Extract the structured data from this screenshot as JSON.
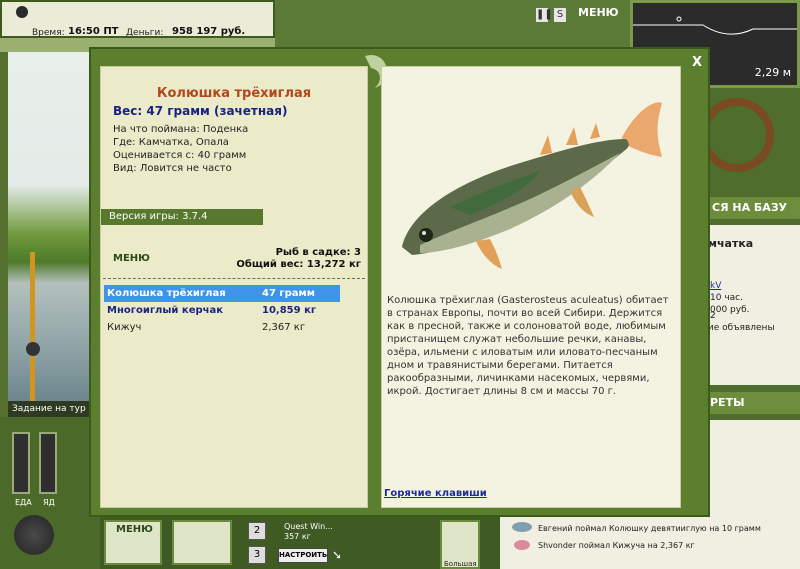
{
  "status": {
    "time_label": "Время:",
    "time_value": "16:50 ПТ",
    "money_label": "Деньги:",
    "money_value": "958 197 руб."
  },
  "top_right": {
    "menu_label": "МЕНЮ",
    "depth": "2,29 м",
    "pause_icon": "pause-icon",
    "speed_icon": "s-icon"
  },
  "background": {
    "task_label": "Задание на тур",
    "food_label": "ЕДА",
    "water_label": "ЯД",
    "base_button": "СЯ НА БАЗУ",
    "location_title": "мчатка",
    "loc_line1": "kV",
    "loc_line2": "10 час.",
    "loc_line3": "000 руб.",
    "loc_line4": "2",
    "loc_line5": "ние объявлены",
    "secrets_button": "РЕТЫ",
    "feed1": "Евгений поймал Колюшку девятииглую на 10 грамм",
    "feed2": "Shvonder поймал Кижуча на 2,367 кг",
    "bottom_menu": "МЕНЮ",
    "quest_title": "Quest Win...",
    "quest_weight": "357 кг",
    "setup_button": "НАСТРОИТЬ",
    "num2": "2",
    "num3": "3",
    "big_label": "Большая"
  },
  "dialog": {
    "close_label": "X",
    "fish_name": "Колюшка трёхиглая",
    "weight_line": "Вес: 47 грамм (зачетная)",
    "caught_on": "На что поймана: Поденка",
    "location": "Где: Камчатка, Опала",
    "rated_from": "Оценивается с: 40 грамм",
    "species_frequency": "Вид: Ловится не часто",
    "version": "Версия игры: 3.7.4",
    "menu_link": "МЕНЮ",
    "cage_count": "Рыб в садке: 3",
    "cage_total": "Общий вес: 13,272 кг",
    "catches": [
      {
        "name": "Колюшка трёхиглая",
        "weight": "47 грамм",
        "state": "selected"
      },
      {
        "name": "Многоиглый керчак",
        "weight": "10,859 кг",
        "state": "bold"
      },
      {
        "name": "Кижуч",
        "weight": "2,367 кг",
        "state": "plain"
      }
    ],
    "description": "Колюшка трёхиглая (Gasterosteus aculeatus) обитает в странах Европы, почти во всей Сибири. Держится как в пресной, также и солоноватой воде, любимым пристанищем служат небольшие речки, канавы, озёра, ильмени с иловатым или иловато-песчаным дном и травянистыми берегами. Питается ракообразными, личинками насекомых, червями, икрой. Достигает длины 8 см и массы 70 г.",
    "hotkeys_link": "Горячие клавиши"
  },
  "colors": {
    "fish_name": "#b4461b",
    "weight": "#1a2283",
    "selected_row": "#3f94ea",
    "frame_green": "#5b7f2f"
  }
}
